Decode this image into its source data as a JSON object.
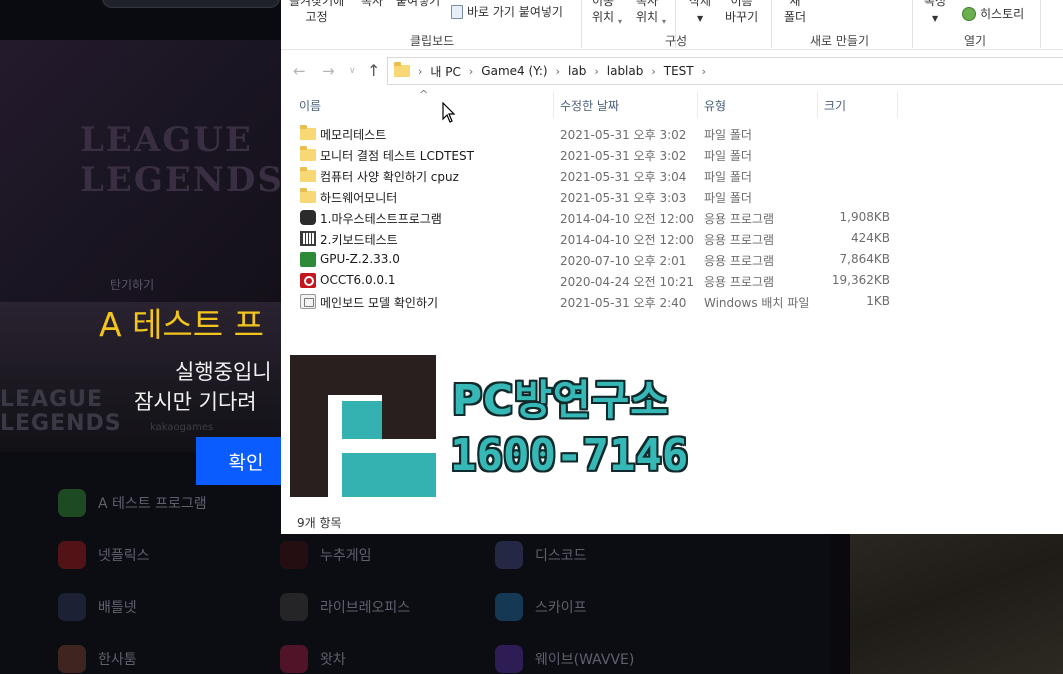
{
  "background_app": {
    "play_label": "탄기하기",
    "test_title": "A 테스트 프",
    "running_text": "실행중입니",
    "wait_text": "잠시만 기다려",
    "confirm_button": "확인",
    "publisher": "kakaogames",
    "game_logo_text": "LEAGUE\nLEGENDS",
    "banner_logo_text": "LEAGUE\nLEGENDS",
    "apps": [
      {
        "label": "A 테스트 프로그램",
        "color": "#2e7d32"
      },
      {
        "label": "넷플릭스",
        "color": "#8b1a1a"
      },
      {
        "label": "누추게임",
        "color": "#3a1010"
      },
      {
        "label": "디스코드",
        "color": "#3b3f6e"
      },
      {
        "label": "배틀넷",
        "color": "#2a3550"
      },
      {
        "label": "라이브레오피스",
        "color": "#3a3a3a"
      },
      {
        "label": "스카이프",
        "color": "#1d5c8a"
      },
      {
        "label": "한사툼",
        "color": "#6a3a2a"
      },
      {
        "label": "왓차",
        "color": "#8a1a3a"
      },
      {
        "label": "웨이브(WAVVE)",
        "color": "#4a2a8a"
      }
    ]
  },
  "explorer": {
    "ribbon": {
      "pin_label": "즐겨찾기에\n고정",
      "copy_label": "복사",
      "paste_label": "붙여넣기",
      "paste_shortcut_label": "바로 가기 붙여넣기",
      "move_label": "이동\n위치",
      "copy_to_label": "복사\n위치",
      "delete_label": "삭제",
      "rename_label": "이름\n바꾸기",
      "new_folder_label": "새\n폴더",
      "properties_label": "속성",
      "history_label": "히스토리",
      "group_clipboard": "클립보드",
      "group_organize": "구성",
      "group_new": "새로 만들기",
      "group_open": "열기"
    },
    "breadcrumb": [
      "내 PC",
      "Game4 (Y:)",
      "lab",
      "lablab",
      "TEST"
    ],
    "columns": {
      "name": "이름",
      "date": "수정한 날짜",
      "type": "유형",
      "size": "크기"
    },
    "files": [
      {
        "icon": "folder",
        "name": "메모리테스트",
        "date": "2021-05-31 오후 3:02",
        "type": "파일 폴더",
        "size": ""
      },
      {
        "icon": "folder",
        "name": "모니터 결점 테스트 LCDTEST",
        "date": "2021-05-31 오후 3:02",
        "type": "파일 폴더",
        "size": ""
      },
      {
        "icon": "folder",
        "name": "컴퓨터 사양 확인하기 cpuz",
        "date": "2021-05-31 오후 3:04",
        "type": "파일 폴더",
        "size": ""
      },
      {
        "icon": "folder",
        "name": "하드웨어모니터",
        "date": "2021-05-31 오후 3:03",
        "type": "파일 폴더",
        "size": ""
      },
      {
        "icon": "app-mouse",
        "name": "1.마우스테스트프로그램",
        "date": "2014-04-10 오전 12:00",
        "type": "응용 프로그램",
        "size": "1,908KB"
      },
      {
        "icon": "app-keyboard",
        "name": "2.키보드테스트",
        "date": "2014-04-10 오전 12:00",
        "type": "응용 프로그램",
        "size": "424KB"
      },
      {
        "icon": "app-gpuz",
        "name": "GPU-Z.2.33.0",
        "date": "2020-07-10 오후 2:01",
        "type": "응용 프로그램",
        "size": "7,864KB"
      },
      {
        "icon": "app-occt",
        "name": "OCCT6.0.0.1",
        "date": "2020-04-24 오전 10:21",
        "type": "응용 프로그램",
        "size": "19,362KB"
      },
      {
        "icon": "batch",
        "name": "메인보드 모델 확인하기",
        "date": "2021-05-31 오후 2:40",
        "type": "Windows 배치 파일",
        "size": "1KB"
      }
    ],
    "status": "9개 항목"
  },
  "watermark": {
    "brand": "PC방연구소",
    "phone": "1600-7146",
    "brand_color": "#36b8b6"
  }
}
